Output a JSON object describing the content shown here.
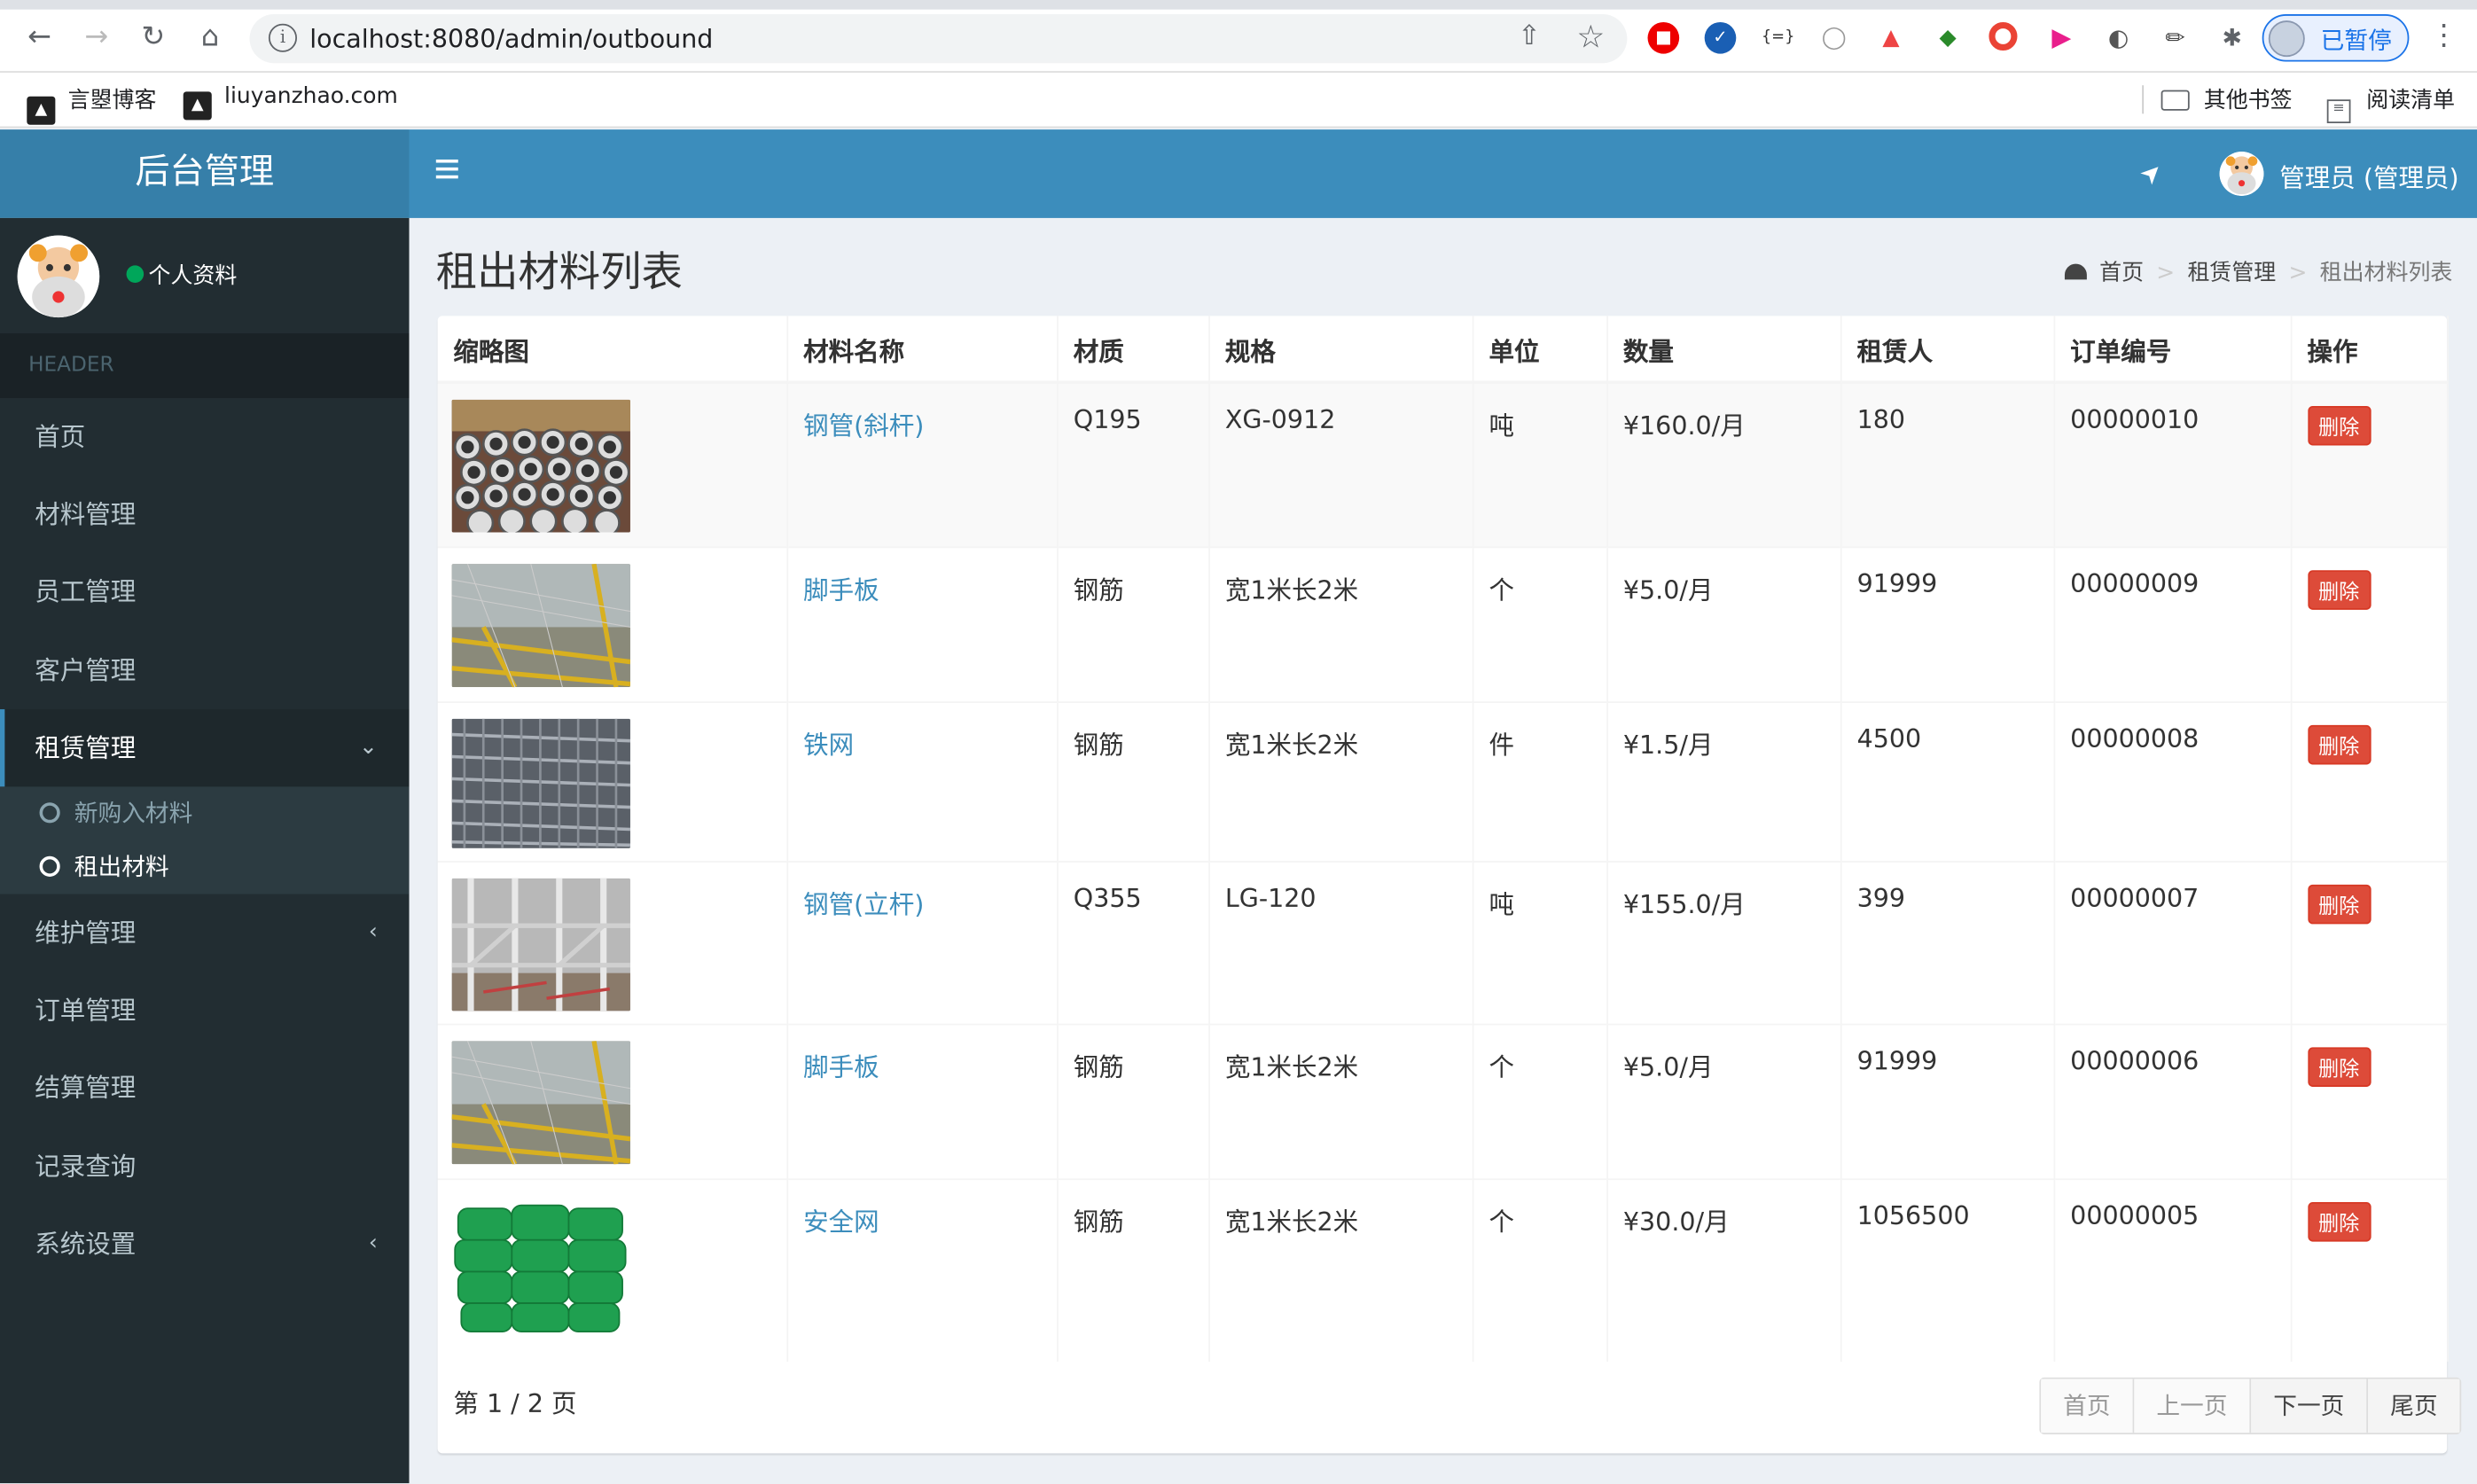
{
  "browser": {
    "url": "localhost:8080/admin/outbound",
    "profile_status": "已暂停",
    "bookmarks": [
      "言曌博客",
      "liuyanzhao.com"
    ],
    "bookmarks_right": [
      "其他书签",
      "阅读清单"
    ]
  },
  "header": {
    "logo": "后台管理",
    "user_name": "管理员 (管理员)"
  },
  "sidebar": {
    "profile_label": "个人资料",
    "section_header": "HEADER",
    "items": [
      {
        "label": "首页"
      },
      {
        "label": "材料管理"
      },
      {
        "label": "员工管理"
      },
      {
        "label": "客户管理"
      },
      {
        "label": "租赁管理"
      },
      {
        "label": "维护管理"
      },
      {
        "label": "订单管理"
      },
      {
        "label": "结算管理"
      },
      {
        "label": "记录查询"
      },
      {
        "label": "系统设置"
      }
    ],
    "submenu": [
      {
        "label": "新购入材料"
      },
      {
        "label": "租出材料"
      }
    ]
  },
  "page": {
    "title": "租出材料列表",
    "breadcrumb": [
      "首页",
      "租赁管理",
      "租出材料列表"
    ]
  },
  "table": {
    "columns": [
      "缩略图",
      "材料名称",
      "材质",
      "规格",
      "单位",
      "数量",
      "租赁人",
      "订单编号",
      "操作"
    ],
    "rows": [
      {
        "name": "钢管(斜杆)",
        "material": "Q195",
        "spec": "XG-0912",
        "unit": "吨",
        "qty": "¥160.0/月",
        "renter": "180",
        "order": "00000010",
        "action": "删除",
        "thumb": "pipes"
      },
      {
        "name": "脚手板",
        "material": "钢筋",
        "spec": "宽1米长2米",
        "unit": "个",
        "qty": "¥5.0/月",
        "renter": "91999",
        "order": "00000009",
        "action": "删除",
        "thumb": "scaffold"
      },
      {
        "name": "铁网",
        "material": "钢筋",
        "spec": "宽1米长2米",
        "unit": "件",
        "qty": "¥1.5/月",
        "renter": "4500",
        "order": "00000008",
        "action": "删除",
        "thumb": "mesh"
      },
      {
        "name": "钢管(立杆)",
        "material": "Q355",
        "spec": "LG-120",
        "unit": "吨",
        "qty": "¥155.0/月",
        "renter": "399",
        "order": "00000007",
        "action": "删除",
        "thumb": "frame"
      },
      {
        "name": "脚手板",
        "material": "钢筋",
        "spec": "宽1米长2米",
        "unit": "个",
        "qty": "¥5.0/月",
        "renter": "91999",
        "order": "00000006",
        "action": "删除",
        "thumb": "scaffold"
      },
      {
        "name": "安全网",
        "material": "钢筋",
        "spec": "宽1米长2米",
        "unit": "个",
        "qty": "¥30.0/月",
        "renter": "1056500",
        "order": "00000005",
        "action": "删除",
        "thumb": "net"
      }
    ]
  },
  "pagination": {
    "info": "第 1 / 2 页",
    "first": "首页",
    "prev": "上一页",
    "next": "下一页",
    "last": "尾页"
  }
}
